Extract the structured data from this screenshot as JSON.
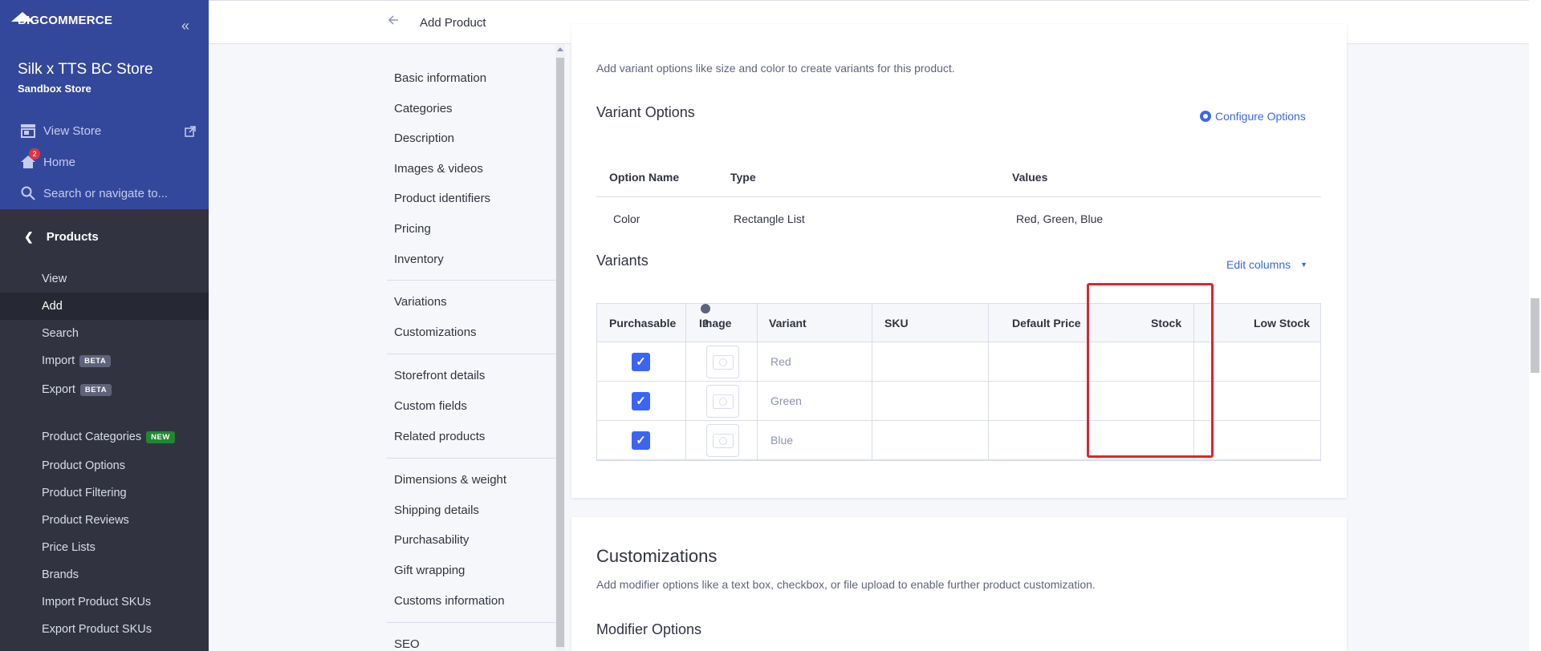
{
  "brand": {
    "logo_text": "BIGCOMMERCE"
  },
  "store": {
    "name": "Silk x TTS BC Store",
    "type": "Sandbox Store"
  },
  "top_links": {
    "view_store": "View Store",
    "home": "Home",
    "home_badge": "2",
    "search": "Search or navigate to..."
  },
  "sidebar": {
    "section": "Products",
    "items": [
      {
        "label": "View"
      },
      {
        "label": "Add"
      },
      {
        "label": "Search"
      },
      {
        "label": "Import",
        "tag": "BETA"
      },
      {
        "label": "Export",
        "tag": "BETA"
      },
      {
        "label": "Product Categories",
        "tag": "NEW"
      },
      {
        "label": "Product Options"
      },
      {
        "label": "Product Filtering"
      },
      {
        "label": "Product Reviews"
      },
      {
        "label": "Price Lists"
      },
      {
        "label": "Brands"
      },
      {
        "label": "Import Product SKUs"
      },
      {
        "label": "Export Product SKUs"
      }
    ]
  },
  "header": {
    "title": "Add Product"
  },
  "page_nav": [
    "Basic information",
    "Categories",
    "Description",
    "Images & videos",
    "Product identifiers",
    "Pricing",
    "Inventory",
    "Variations",
    "Customizations",
    "Storefront details",
    "Custom fields",
    "Related products",
    "Dimensions & weight",
    "Shipping details",
    "Purchasability",
    "Gift wrapping",
    "Customs information",
    "SEO"
  ],
  "variations": {
    "title": "Variations",
    "desc": "Add variant options like size and color to create variants for this product.",
    "options_title": "Variant Options",
    "configure_label": "Configure Options",
    "options_headers": {
      "name": "Option Name",
      "type": "Type",
      "values": "Values"
    },
    "options_rows": [
      {
        "name": "Color",
        "type": "Rectangle List",
        "values": "Red, Green, Blue"
      }
    ],
    "variants_title": "Variants",
    "edit_columns_label": "Edit columns",
    "variant_headers": {
      "purchasable": "Purchasable",
      "image": "Image",
      "variant": "Variant",
      "sku": "SKU",
      "default_price": "Default Price",
      "stock": "Stock",
      "low_stock": "Low Stock"
    },
    "variant_rows": [
      {
        "name": "Red",
        "purchasable": true
      },
      {
        "name": "Green",
        "purchasable": true
      },
      {
        "name": "Blue",
        "purchasable": true
      }
    ]
  },
  "customizations": {
    "title": "Customizations",
    "desc": "Add modifier options like a text box, checkbox, or file upload to enable further product customization.",
    "modifier_title": "Modifier Options"
  },
  "colors": {
    "sidebar": "#313440",
    "sidebar_top": "#34489b",
    "accent": "#3c64f4",
    "highlight": "#e8202a",
    "new_tag": "#208831"
  }
}
